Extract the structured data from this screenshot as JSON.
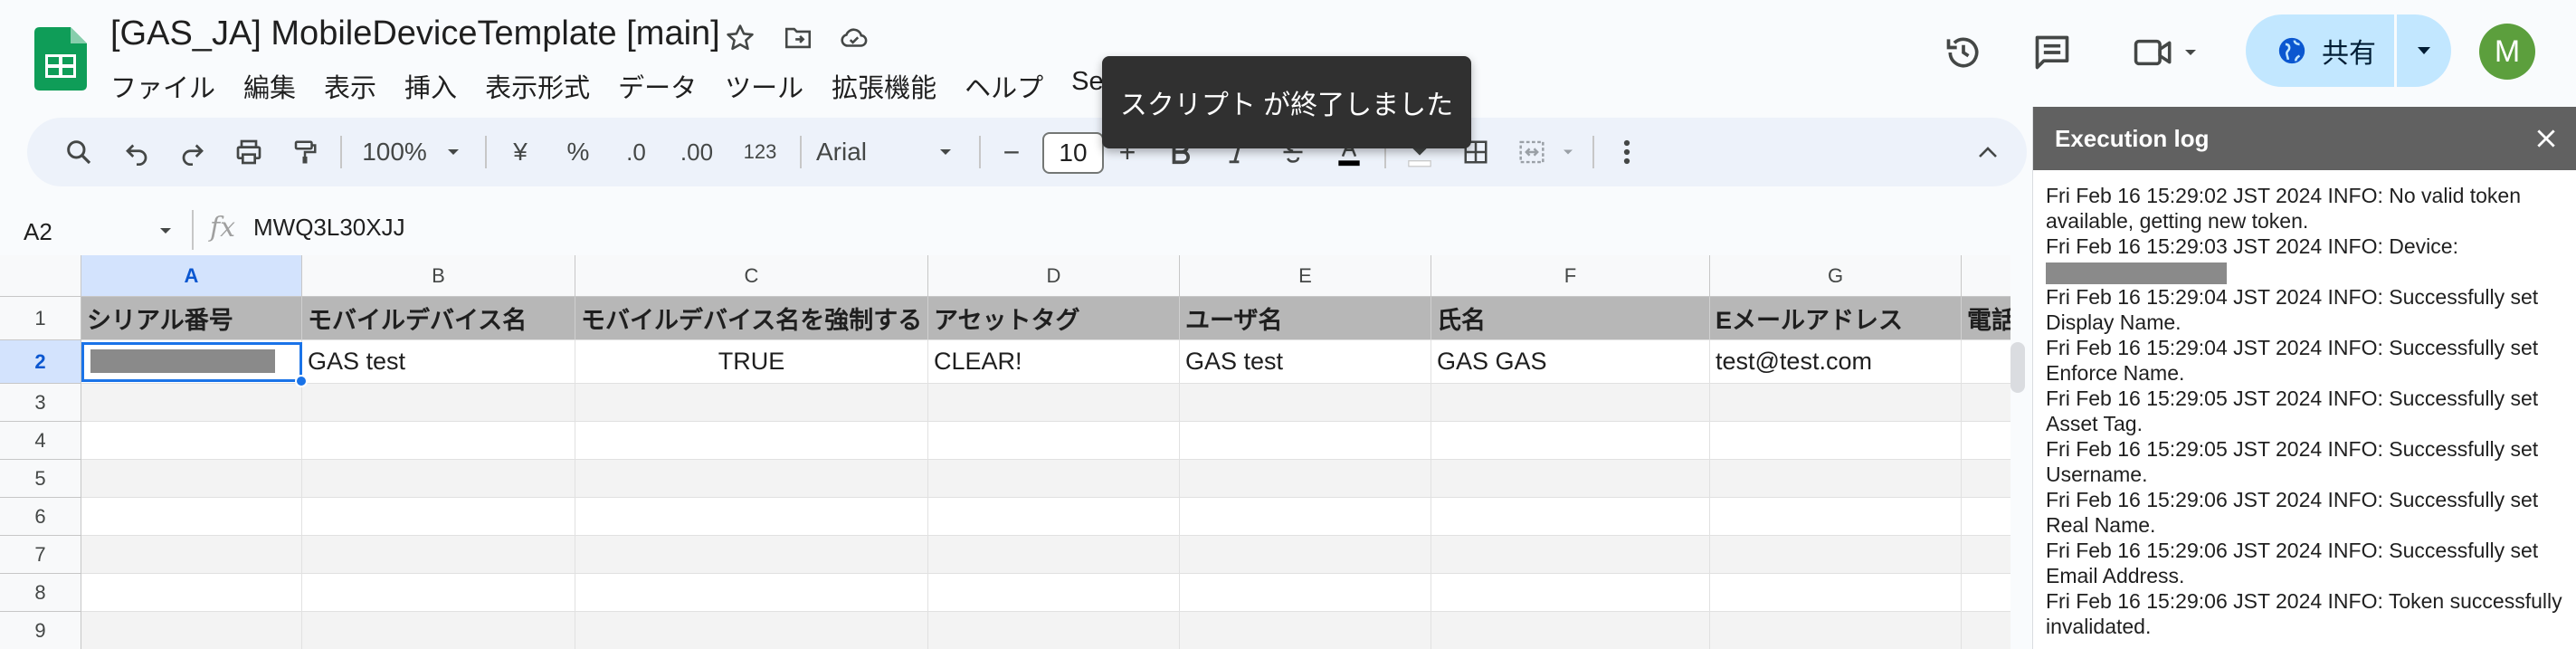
{
  "header": {
    "title": "[GAS_JA] MobileDeviceTemplate [main]",
    "menu": [
      "ファイル",
      "編集",
      "表示",
      "挿入",
      "表示形式",
      "データ",
      "ツール",
      "拡張機能",
      "ヘルプ",
      "Set"
    ],
    "share_label": "共有",
    "avatar_letter": "M"
  },
  "toast": {
    "message": "スクリプト が終了しました"
  },
  "toolbar": {
    "zoom": "100%",
    "currency": "¥",
    "percent": "%",
    "decrease_decimals": ".0",
    "increase_decimals": ".00",
    "number_format": "123",
    "font": "Arial",
    "font_size": "10",
    "minus": "−",
    "plus": "+"
  },
  "formula_bar": {
    "name_box": "A2",
    "fx": "fx",
    "value": "MWQ3L30XJJ"
  },
  "grid": {
    "columns": [
      "A",
      "B",
      "C",
      "D",
      "E",
      "F",
      "G"
    ],
    "rows": [
      "1",
      "2",
      "3",
      "4",
      "5",
      "6",
      "7",
      "8",
      "9"
    ],
    "headers": [
      "シリアル番号",
      "モバイルデバイス名",
      "モバイルデバイス名を強制する",
      "アセットタグ",
      "ユーザ名",
      "氏名",
      "Eメールアドレス",
      "電話"
    ],
    "row2": [
      "",
      "GAS test",
      "TRUE",
      "CLEAR!",
      "GAS test",
      "GAS GAS",
      "test@test.com",
      ""
    ]
  },
  "execution_log": {
    "title": "Execution log",
    "lines": [
      "Fri Feb 16 15:29:02 JST 2024 INFO: No valid token available, getting new token.",
      "Fri Feb 16 15:29:03 JST 2024 INFO: Device:",
      "Fri Feb 16 15:29:04 JST 2024 INFO: Successfully set Display Name.",
      "Fri Feb 16 15:29:04 JST 2024 INFO: Successfully set Enforce Name.",
      "Fri Feb 16 15:29:05 JST 2024 INFO: Successfully set Asset Tag.",
      "Fri Feb 16 15:29:05 JST 2024 INFO: Successfully set Username.",
      "Fri Feb 16 15:29:06 JST 2024 INFO: Successfully set Real Name.",
      "Fri Feb 16 15:29:06 JST 2024 INFO: Successfully set Email Address.",
      "Fri Feb 16 15:29:06 JST 2024 INFO: Token successfully invalidated."
    ]
  },
  "colors": {
    "accent": "#1a73e8",
    "share_bg": "#c2e7ff",
    "log_header_bg": "#616161",
    "header_row_bg": "#b7b7b7"
  }
}
